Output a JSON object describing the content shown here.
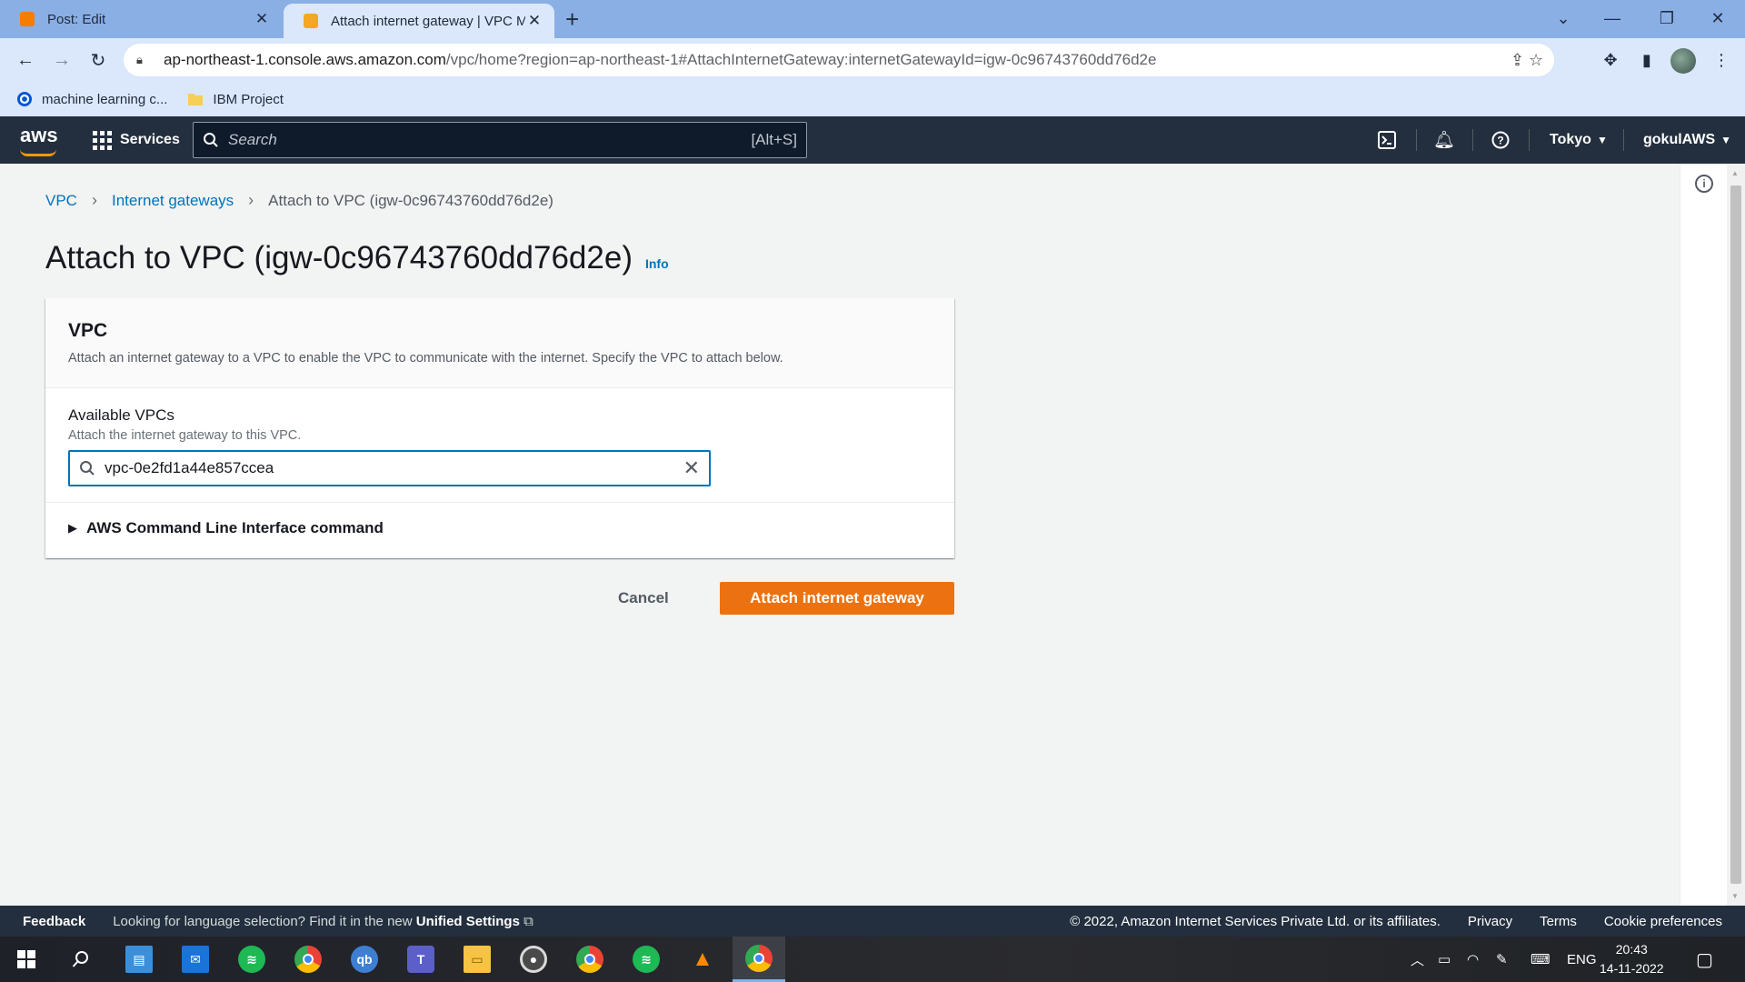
{
  "browser": {
    "tabs": [
      {
        "title": "Post: Edit",
        "active": false
      },
      {
        "title": "Attach internet gateway | VPC Ma",
        "active": true
      }
    ],
    "url_host": "ap-northeast-1.console.aws.amazon.com",
    "url_path": "/vpc/home?region=ap-northeast-1#AttachInternetGateway:internetGatewayId=igw-0c96743760dd76d2e",
    "bookmarks": [
      "machine learning c...",
      "IBM Project"
    ]
  },
  "aws_nav": {
    "logo": "aws",
    "services_label": "Services",
    "search_placeholder": "Search",
    "search_shortcut": "[Alt+S]",
    "region": "Tokyo",
    "account": "gokulAWS"
  },
  "breadcrumb": {
    "items": [
      "VPC",
      "Internet gateways",
      "Attach to VPC (igw-0c96743760dd76d2e)"
    ]
  },
  "page": {
    "title": "Attach to VPC (igw-0c96743760dd76d2e)",
    "info_link": "Info"
  },
  "panel": {
    "heading": "VPC",
    "description": "Attach an internet gateway to a VPC to enable the VPC to communicate with the internet. Specify the VPC to attach below.",
    "field_label": "Available VPCs",
    "field_description": "Attach the internet gateway to this VPC.",
    "field_value": "vpc-0e2fd1a44e857ccea",
    "expander_label": "AWS Command Line Interface command"
  },
  "actions": {
    "cancel": "Cancel",
    "primary": "Attach internet gateway"
  },
  "footer": {
    "feedback": "Feedback",
    "language_text": "Looking for language selection? Find it in the new",
    "language_link": "Unified Settings",
    "copyright": "© 2022, Amazon Internet Services Private Ltd. or its affiliates.",
    "links": [
      "Privacy",
      "Terms",
      "Cookie preferences"
    ]
  },
  "taskbar": {
    "language": "ENG",
    "time": "20:43",
    "date": "14-11-2022"
  },
  "colors": {
    "aws_nav": "#232f3e",
    "primary_button": "#ec7211",
    "link": "#0073bb",
    "chrome_frame": "#89afe5"
  }
}
